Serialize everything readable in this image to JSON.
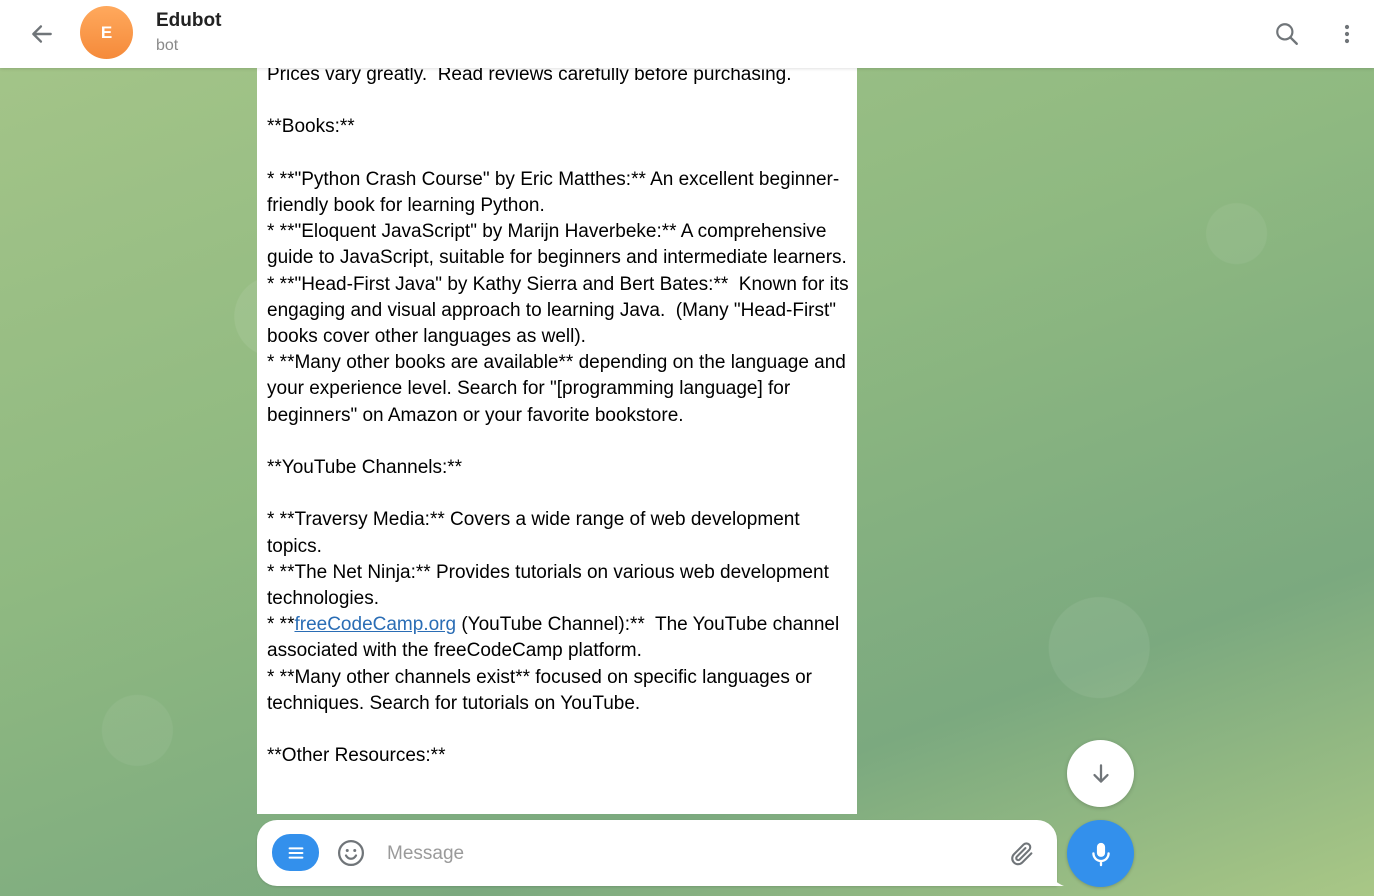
{
  "header": {
    "back_icon": "arrow-left-icon",
    "avatar_letter": "E",
    "title": "Edubot",
    "subtitle": "bot",
    "search_icon": "search-icon",
    "more_icon": "more-vertical-icon"
  },
  "message": {
    "lines": [
      "Prices vary greatly.  Read reviews carefully before purchasing.",
      "",
      "**Books:**",
      "",
      "* **\"Python Crash Course\" by Eric Matthes:** An excellent beginner-friendly book for learning Python.",
      "* **\"Eloquent JavaScript\" by Marijn Haverbeke:** A comprehensive guide to JavaScript, suitable for beginners and intermediate learners.",
      "* **\"Head-First Java\" by Kathy Sierra and Bert Bates:**  Known for its engaging and visual approach to learning Java.  (Many \"Head-First\" books cover other languages as well).",
      "* **Many other books are available** depending on the language and your experience level. Search for \"[programming language] for beginners\" on Amazon or your favorite bookstore.",
      "",
      "**YouTube Channels:**",
      "",
      "* **Traversy Media:** Covers a wide range of web development topics.",
      "* **The Net Ninja:** Provides tutorials on various web development technologies."
    ],
    "fcc_prefix": "* **",
    "fcc_link": "freeCodeCamp.org",
    "fcc_suffix": " (YouTube Channel):**  The YouTube channel associated with the freeCodeCamp platform.",
    "lines_after": [
      "* **Many other channels exist** focused on specific languages or techniques. Search for tutorials on YouTube.",
      "",
      "**Other Resources:**"
    ]
  },
  "composer": {
    "placeholder": "Message",
    "value": ""
  },
  "colors": {
    "accent": "#3390ec",
    "avatar": "#f58a3a",
    "link": "#2a6db5"
  }
}
